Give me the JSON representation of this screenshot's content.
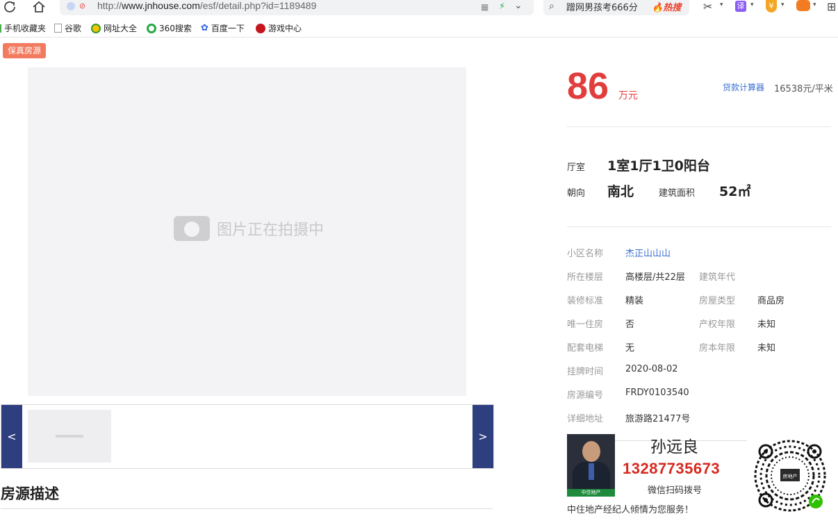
{
  "browser": {
    "url_prefix": "http://",
    "url_host": "www.jnhouse.com",
    "url_path": "/esf/detail.php?id=1189489",
    "search_text": "蹭网男孩考666分",
    "hot_label": "热搜",
    "translate_label": "译",
    "bookmarks": [
      "手机收藏夹",
      "谷歌",
      "网址大全",
      "360搜索",
      "百度一下",
      "游戏中心"
    ]
  },
  "listing": {
    "badge": "保真房源",
    "image_placeholder": "图片正在拍摄中",
    "prev": "<",
    "next": ">",
    "desc_title": "房源描述"
  },
  "price": {
    "value": "86",
    "unit": "万元",
    "calc_link": "贷款计算器",
    "unit_price": "16538元/平米"
  },
  "summary": {
    "layout_label": "厅室",
    "layout_value": "1室1厅1卫0阳台",
    "orientation_label": "朝向",
    "orientation_value": "南北",
    "area_label": "建筑面积",
    "area_value": "52㎡"
  },
  "details": {
    "community_label": "小区名称",
    "community_value": "杰正山山山",
    "floor_label": "所在楼层",
    "floor_value": "高楼层/共22层",
    "build_year_label": "建筑年代",
    "decoration_label": "装修标准",
    "decoration_value": "精装",
    "house_type_label": "房屋类型",
    "house_type_value": "商品房",
    "only_home_label": "唯一住房",
    "only_home_value": "否",
    "property_years_label": "产权年限",
    "property_years_value": "未知",
    "elevator_label": "配套电梯",
    "elevator_value": "无",
    "house_years_label": "房本年限",
    "house_years_value": "未知",
    "listed_label": "挂牌时间",
    "listed_value": "2020-08-02",
    "code_label": "房源编号",
    "code_value": "FRDY0103540",
    "address_label": "详细地址",
    "address_value": "旅游路21477号"
  },
  "agent": {
    "name": "孙远良",
    "phone": "13287735673",
    "scan_text": "微信扫码拨号",
    "slogan": "中住地产经纪人倾情为您服务！",
    "brand": "中住地产",
    "qr_center": "房地产"
  },
  "colors": {
    "price_red": "#e23d3d",
    "link_blue": "#3a6fd0",
    "nav_arrow_bg": "#2e3f7f",
    "badge_bg": "#f27a5e"
  }
}
